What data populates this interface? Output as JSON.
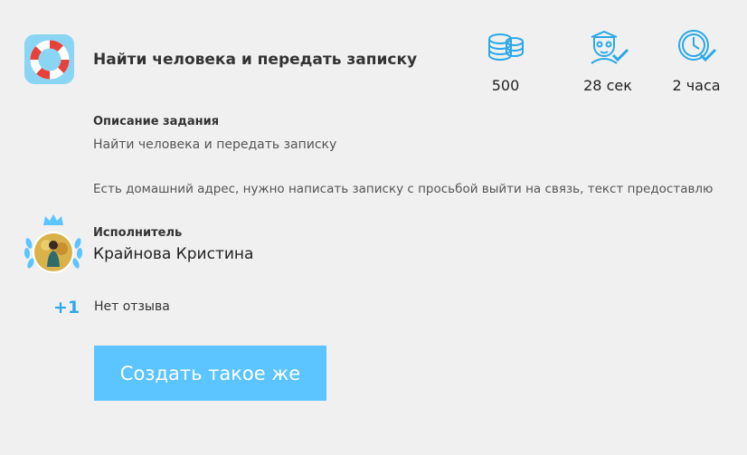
{
  "task": {
    "title": "Найти человека и передать записку",
    "icon": "lifebuoy-icon"
  },
  "stats": {
    "reward": {
      "value": "500",
      "icon": "coins-icon"
    },
    "time": {
      "value": "28 сек",
      "icon": "person-check-icon"
    },
    "deadline": {
      "value": "2 часа",
      "icon": "clock-check-icon"
    }
  },
  "description": {
    "heading": "Описание задания",
    "line1": "Найти человека и передать записку",
    "line2": "Есть домашний адрес, нужно написать записку с просьбой выйти на связь, текст предоставлю"
  },
  "executor": {
    "heading": "Исполнитель",
    "name": "Крайнова Кристина",
    "avatar_icon": "crown-laurel-avatar"
  },
  "rating": {
    "score": "+1",
    "review": "Нет отзыва"
  },
  "actions": {
    "create_label": "Создать такое же"
  },
  "colors": {
    "background": "#f0f0f0",
    "accent": "#5cc4ff",
    "icon_blue": "#2aa8e8",
    "lifebuoy_red": "#e8403a"
  }
}
